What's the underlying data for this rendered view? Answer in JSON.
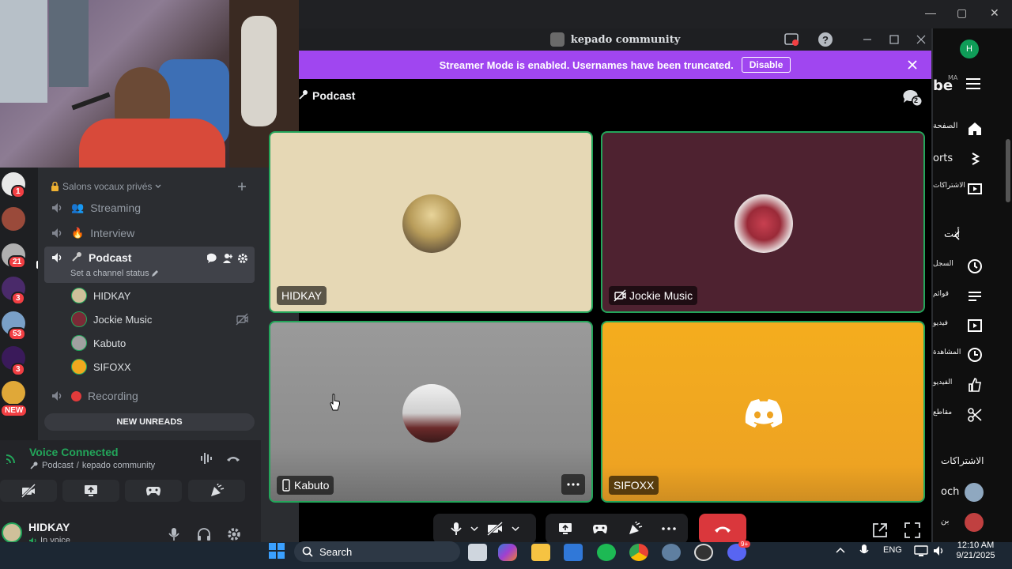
{
  "browser": {
    "window_controls": {
      "minimize": "—",
      "maximize": "▢",
      "close": "✕"
    },
    "profile_initial": "H",
    "youtube_logo_fragment": "be",
    "youtube_region": "MA",
    "sidebar_labels": [
      "الصفحة",
      "orts",
      "الاشتراكات",
      "أنت",
      "السجل",
      "قوائم",
      "فيديو",
      "المشاهدة",
      "الفيديو",
      "مقاطع",
      "الاشتراكات",
      "och",
      "بن"
    ]
  },
  "discord": {
    "window_title": "kepado community",
    "streamer_banner": {
      "message": "Streamer Mode is enabled. Usernames have been truncated.",
      "button_label": "Disable"
    },
    "call_header": {
      "channel_name": "Podcast",
      "participants_badge": "2"
    },
    "servers": [
      {
        "badge": "1"
      },
      {
        "badge": ""
      },
      {
        "badge": "21"
      },
      {
        "badge": "3"
      },
      {
        "badge": "53"
      },
      {
        "badge": "3"
      },
      {
        "badge": "NEW"
      }
    ],
    "category_label": "Salons vocaux privés",
    "channels": {
      "streaming": "Streaming",
      "interview": "Interview",
      "podcast": "Podcast",
      "podcast_status": "Set a channel status",
      "recording": "Recording"
    },
    "voice_users": [
      "HIDKAY",
      "Jockie Music",
      "Kabuto",
      "SIFOXX"
    ],
    "new_unreads": "NEW UNREADS",
    "voice_panel": {
      "status": "Voice Connected",
      "location_channel": "Podcast",
      "location_separator": " / ",
      "location_server": "kepado community"
    },
    "user_panel": {
      "username": "HIDKAY",
      "status": "In voice"
    },
    "tiles": [
      {
        "name": "HIDKAY",
        "bg": "#e6d8b5"
      },
      {
        "name": "Jockie Music",
        "bg": "#4e2230"
      },
      {
        "name": "Kabuto",
        "bg": "#9a9a9a"
      },
      {
        "name": "SIFOXX",
        "bg": "#f0a81e"
      }
    ],
    "call_controls": {
      "notification_badge": "9+"
    }
  },
  "taskbar": {
    "search_placeholder": "Search",
    "language": "ENG",
    "time": "12:10 AM",
    "date": "9/21/2025"
  },
  "colors": {
    "streamer_purple": "#a046f0",
    "speaking_green": "#23a55a",
    "hangup_red": "#da373c",
    "discord_blurple": "#5865f2"
  }
}
